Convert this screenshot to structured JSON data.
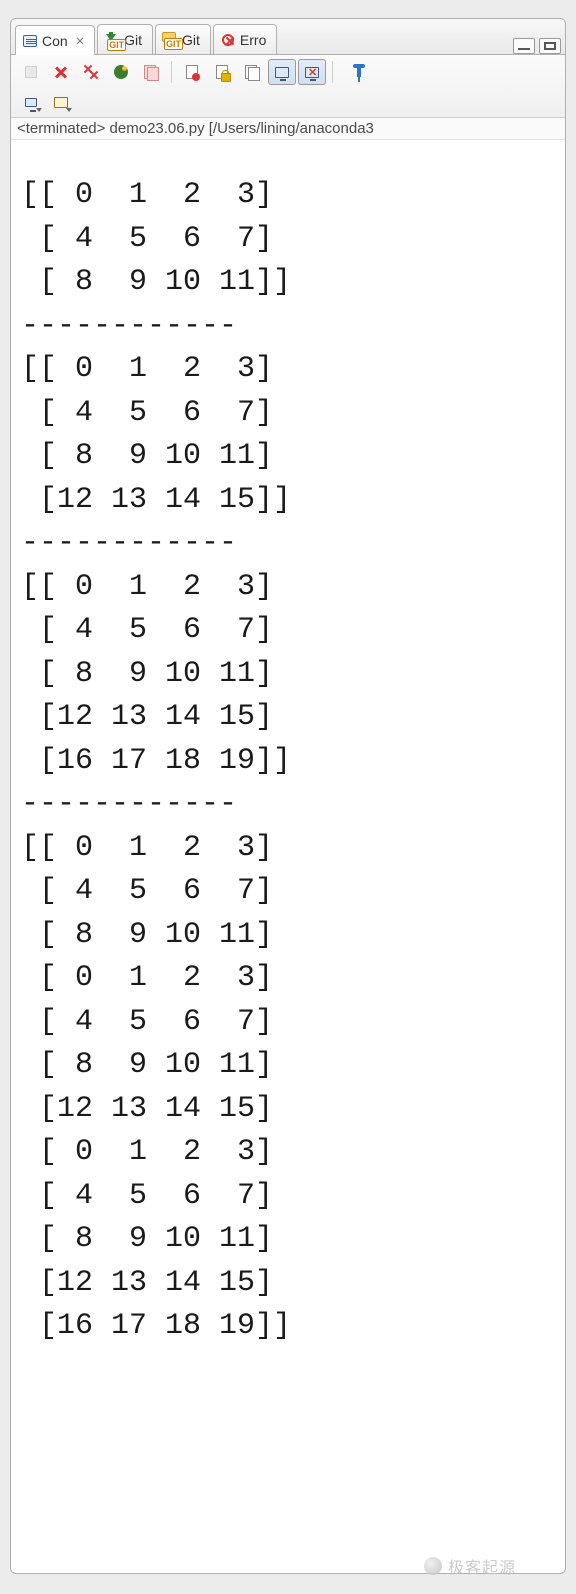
{
  "tabs": [
    {
      "label": "Con",
      "icon": "console-icon",
      "active": true,
      "closable": true
    },
    {
      "label": "Git",
      "icon": "git-staging-icon",
      "active": false,
      "closable": false
    },
    {
      "label": "Git",
      "icon": "git-repo-icon",
      "active": false,
      "closable": false
    },
    {
      "label": "Erro",
      "icon": "error-log-icon",
      "active": false,
      "closable": false
    }
  ],
  "window_buttons": {
    "minimize": "minimize",
    "maximize": "maximize"
  },
  "toolbar_row1": [
    {
      "name": "terminate-button",
      "icon": "stop-icon",
      "disabled": true
    },
    {
      "name": "remove-launch-button",
      "icon": "remove-x-icon",
      "disabled": false
    },
    {
      "name": "remove-all-button",
      "icon": "remove-xx-icon",
      "disabled": false
    },
    {
      "name": "env-button",
      "icon": "env-icon",
      "disabled": false
    },
    {
      "name": "clone-console-button",
      "icon": "docs-pink-icon",
      "disabled": false
    },
    {
      "sep": true
    },
    {
      "name": "clear-console-button",
      "icon": "doc-red-icon",
      "disabled": false
    },
    {
      "name": "scroll-lock-button",
      "icon": "doc-lock-icon",
      "disabled": false
    },
    {
      "name": "show-console-button",
      "icon": "docs-icon",
      "disabled": false
    },
    {
      "name": "show-stdout-button",
      "icon": "monitor-icon",
      "toggled": true
    },
    {
      "name": "show-stderr-button",
      "icon": "monitor-x-icon",
      "toggled": true
    },
    {
      "sep": true
    },
    {
      "name": "pin-console-button",
      "icon": "pin-icon",
      "disabled": false
    }
  ],
  "toolbar_row2": [
    {
      "name": "display-selected-button",
      "icon": "monitor-small-icon",
      "dropdown": true
    },
    {
      "name": "open-console-button",
      "icon": "new-console-icon",
      "dropdown": true
    }
  ],
  "status": "<terminated> demo23.06.py [/Users/lining/anaconda3",
  "console_lines": [
    "[[ 0  1  2  3]",
    " [ 4  5  6  7]",
    " [ 8  9 10 11]]",
    "------------",
    "[[ 0  1  2  3]",
    " [ 4  5  6  7]",
    " [ 8  9 10 11]",
    " [12 13 14 15]]",
    "------------",
    "[[ 0  1  2  3]",
    " [ 4  5  6  7]",
    " [ 8  9 10 11]",
    " [12 13 14 15]",
    " [16 17 18 19]]",
    "------------",
    "[[ 0  1  2  3]",
    " [ 4  5  6  7]",
    " [ 8  9 10 11]",
    " [ 0  1  2  3]",
    " [ 4  5  6  7]",
    " [ 8  9 10 11]",
    " [12 13 14 15]",
    " [ 0  1  2  3]",
    " [ 4  5  6  7]",
    " [ 8  9 10 11]",
    " [12 13 14 15]",
    " [16 17 18 19]]"
  ],
  "watermark": "极客起源"
}
